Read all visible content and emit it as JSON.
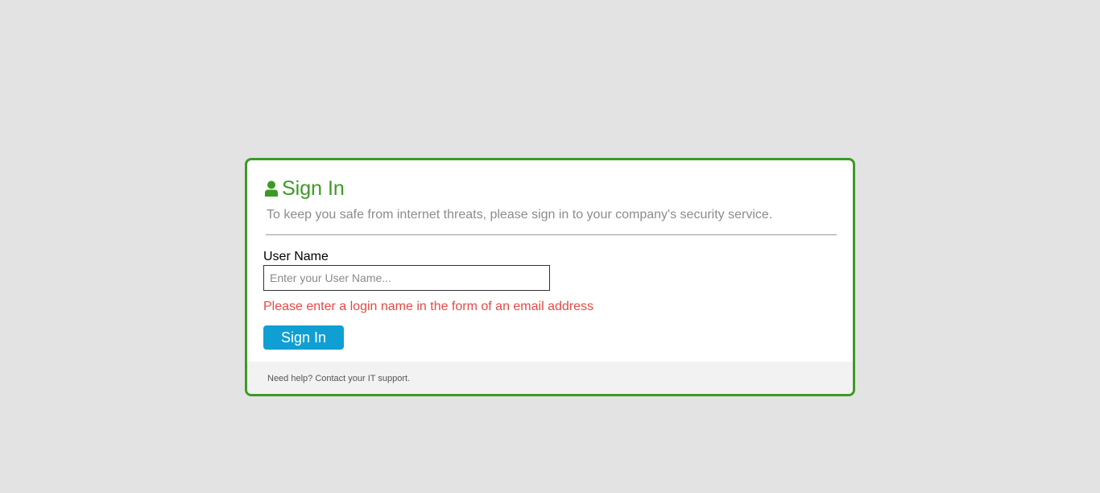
{
  "colors": {
    "accent": "#3c9a24",
    "button": "#109fd3",
    "error": "#e24a46",
    "page_background": "#e3e3e3"
  },
  "signin_card": {
    "icon": "user-icon",
    "title": "Sign In",
    "subtitle": "To keep you safe from internet threats, please sign in to your company's security service.",
    "username_label": "User Name",
    "username_value": "",
    "username_placeholder": "Enter your User Name...",
    "error_message": "Please enter a login name in the form of an email address",
    "submit_label": "Sign In",
    "help_text": "Need help? Contact your IT support."
  }
}
